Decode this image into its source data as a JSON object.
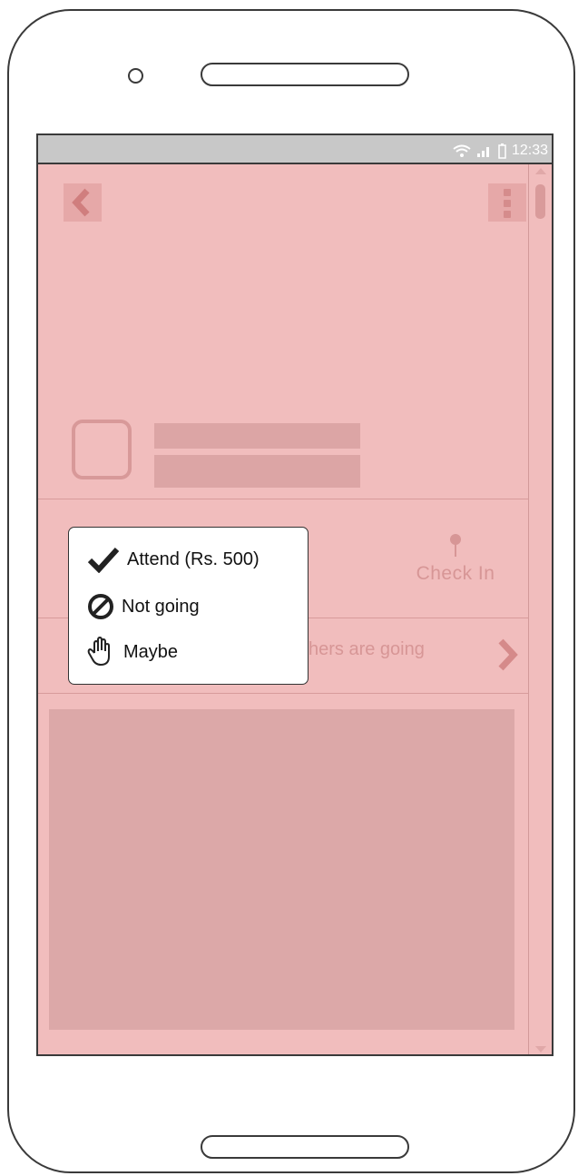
{
  "status_bar": {
    "time": "12:33",
    "icons": [
      "wifi-icon",
      "signal-icon",
      "battery-icon"
    ]
  },
  "toolbar": {
    "back_icon": "chevron-left-icon",
    "menu_icon": "more-vertical-icon"
  },
  "actions": {
    "check_in_label": "Check In"
  },
  "attendees": {
    "label_partial": "hers are going"
  },
  "rsvp_popup": {
    "options": [
      {
        "label": "Attend (Rs. 500)",
        "icon": "checkmark-icon"
      },
      {
        "label": "Not going",
        "icon": "prohibited-icon"
      },
      {
        "label": "Maybe",
        "icon": "hand-icon"
      }
    ]
  },
  "colors": {
    "screen_bg": "#f1bdbd",
    "placeholder": "#dca5a5",
    "accent_text": "#d79696"
  }
}
